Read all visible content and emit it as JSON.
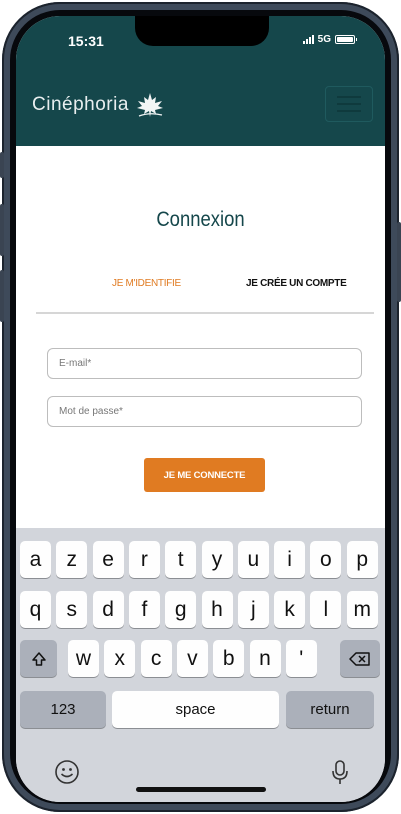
{
  "status": {
    "time": "15:31",
    "network": "5G"
  },
  "header": {
    "brand": "Cinéphoria",
    "logo_icon": "maple-leaf-icon",
    "menu_icon": "hamburger-icon"
  },
  "main": {
    "title": "Connexion",
    "tabs": [
      {
        "label": "JE M'IDENTIFIE",
        "active": true
      },
      {
        "label": "JE CRÉE UN COMPTE",
        "active": false
      }
    ],
    "email": {
      "placeholder": "E-mail*",
      "value": ""
    },
    "password": {
      "placeholder": "Mot de passe*",
      "value": ""
    },
    "submit_label": "JE ME CONNECTE"
  },
  "keyboard": {
    "row1": [
      "a",
      "z",
      "e",
      "r",
      "t",
      "y",
      "u",
      "i",
      "o",
      "p"
    ],
    "row2": [
      "q",
      "s",
      "d",
      "f",
      "g",
      "h",
      "j",
      "k",
      "l",
      "m"
    ],
    "row3": [
      "w",
      "x",
      "c",
      "v",
      "b",
      "n",
      "'"
    ],
    "numbers_label": "123",
    "space_label": "space",
    "return_label": "return",
    "shift_icon": "shift-icon",
    "backspace_icon": "backspace-icon",
    "emoji_icon": "emoji-icon",
    "mic_icon": "microphone-icon"
  },
  "colors": {
    "header_bg": "#15474b",
    "accent": "#e07b22",
    "keyboard_bg": "#d2d5db"
  }
}
